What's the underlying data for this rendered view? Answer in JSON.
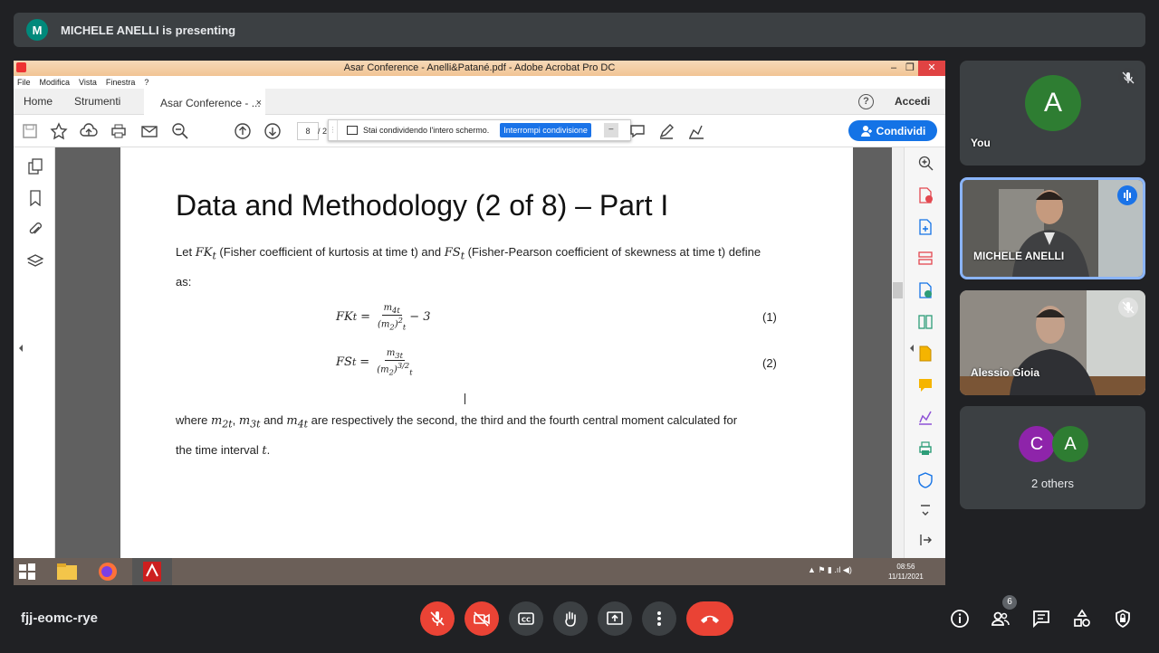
{
  "banner": {
    "avatar_letter": "M",
    "text": "MICHELE ANELLI is presenting"
  },
  "app": {
    "window_title": "Asar Conference - Anelli&Patané.pdf - Adobe Acrobat Pro DC",
    "window_controls": {
      "minimize": "–",
      "maximize": "❐",
      "close": "✕"
    },
    "menu": [
      "File",
      "Modifica",
      "Vista",
      "Finestra",
      "?"
    ],
    "tabs": {
      "home": "Home",
      "tools": "Strumenti",
      "doc": "Asar Conference - ...",
      "close": "×"
    },
    "help": "?",
    "signin": "Accedi",
    "page_current": "8",
    "page_total": "/ 2",
    "share_bar": {
      "grip": "⋮",
      "message": "Stai condividendo l'intero schermo.",
      "stop_button": "Interrompi condivisione",
      "minimize": "–"
    },
    "share_button": "Condividi"
  },
  "document": {
    "title": "Data and Methodology (2 of 8) – Part I",
    "intro": {
      "pre": "Let",
      "fk": "FK",
      "sub_t": "t",
      "mid1": "(Fisher coefficient of kurtosis at time t) and",
      "fs": "FS",
      "mid2": "(Fisher-Pearson coefficient of skewness at time t) define",
      "line2": "as:"
    },
    "eq1": {
      "lhs": "FK",
      "sub": "t",
      "eq": "=",
      "num": "m",
      "num_sub": "4t",
      "den": "(m",
      "den_sub": "2",
      "den_close": ")",
      "den_sup": "2",
      "den_tail": "t",
      "tail": "− 3",
      "number": "(1)"
    },
    "eq2": {
      "lhs": "FS",
      "sub": "t",
      "eq": "=",
      "num": "m",
      "num_sub": "3t",
      "den": "(m",
      "den_sub": "2",
      "den_close": ")",
      "den_sup": "3/2",
      "den_tail": "t",
      "number": "(2)"
    },
    "outro": {
      "pre": "where",
      "m": "m",
      "s2": "2t",
      "c1": ",",
      "s3": "3t",
      "and": "and",
      "s4": "4t",
      "rest": "are respectively the second, the third and the fourth central moment calculated for",
      "line2": "the time interval",
      "tvar": "t",
      "period": "."
    }
  },
  "taskbar": {
    "clock_time": "08:56",
    "clock_date": "11/11/2021",
    "tray": "▲  ⚑  ▮  .ıl  ◀)"
  },
  "participants": {
    "you": {
      "initial": "A",
      "name": "You",
      "color": "#2e7d32"
    },
    "michele": {
      "name": "MICHELE ANELLI"
    },
    "alessio": {
      "name": "Alessio Gioia"
    },
    "others": {
      "initials": [
        "C",
        "A"
      ],
      "colors": [
        "#8e24aa",
        "#2e7d32"
      ],
      "label": "2 others"
    }
  },
  "meeting": {
    "code": "fjj-eomc-rye",
    "participant_count": "6"
  },
  "colors": {
    "accent": "#1473e6",
    "danger": "#ea4335",
    "meet_bg": "#202124",
    "tile_bg": "#3c4043"
  }
}
